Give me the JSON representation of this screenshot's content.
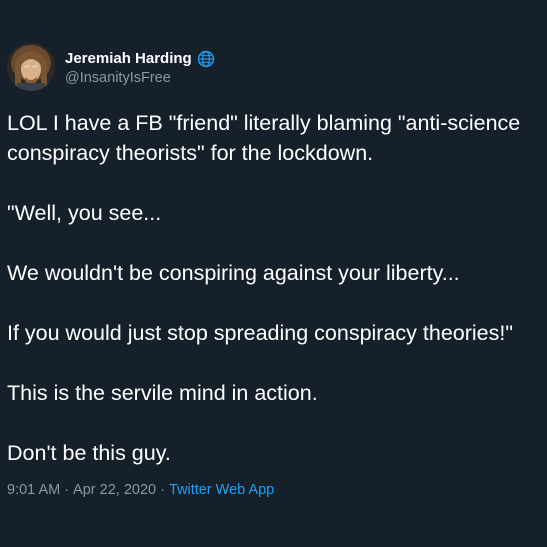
{
  "tweet": {
    "author": {
      "display_name": "Jeremiah Harding",
      "handle": "@InsanityIsFree",
      "badge_icon": "globe-icon",
      "avatar": "avatar-photo"
    },
    "paragraphs": [
      [
        "LOL I have a FB \"friend\" literally blaming \"anti-science",
        "conspiracy theorists\" for the lockdown."
      ],
      [
        "\"Well, you see..."
      ],
      [
        "We wouldn't be conspiring against your liberty..."
      ],
      [
        "If you would just stop spreading conspiracy theories!\""
      ],
      [
        "This is the servile mind in action."
      ],
      [
        "Don't be this guy."
      ]
    ],
    "meta": {
      "time": "9:01 AM",
      "separator": "·",
      "date": "Apr 22, 2020",
      "source": "Twitter Web App"
    }
  },
  "colors": {
    "background": "#15202b",
    "text": "#ffffff",
    "secondary": "#8899a6",
    "link": "#1da1f2"
  }
}
